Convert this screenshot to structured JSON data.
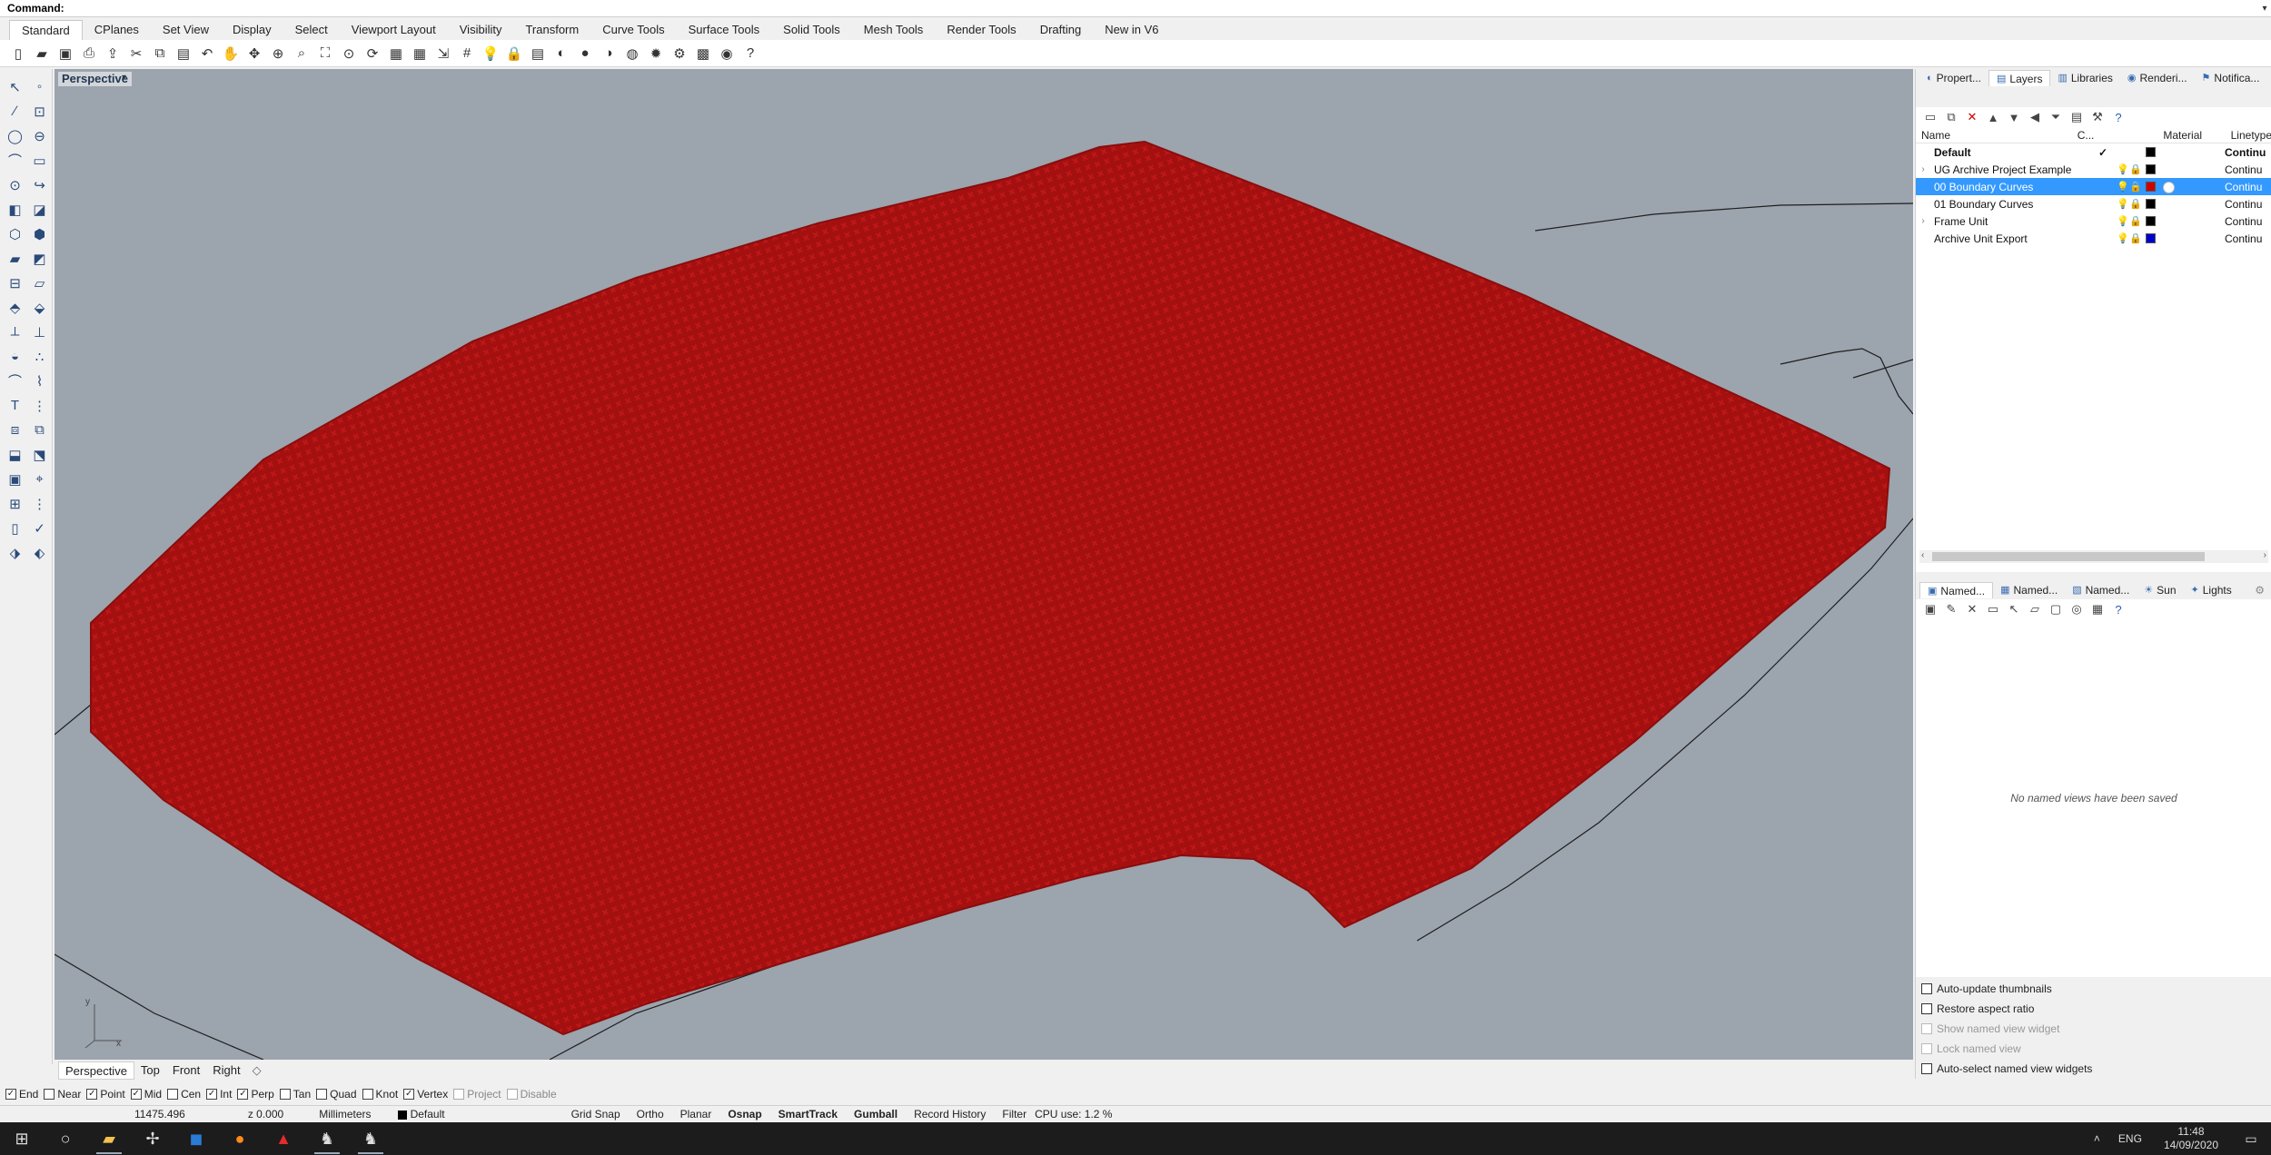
{
  "command": {
    "label": "Command:",
    "value": ""
  },
  "toolbar_tabs": [
    "Standard",
    "CPlanes",
    "Set View",
    "Display",
    "Select",
    "Viewport Layout",
    "Visibility",
    "Transform",
    "Curve Tools",
    "Surface Tools",
    "Solid Tools",
    "Mesh Tools",
    "Render Tools",
    "Drafting",
    "New in V6"
  ],
  "active_toolbar_tab": "Standard",
  "toolbar_icons": [
    "new-icon",
    "open-icon",
    "save-icon",
    "print-icon",
    "import-icon",
    "cut-icon",
    "copy-icon",
    "paste-icon",
    "undo-icon",
    "pan-icon",
    "move-icon",
    "zoom-icon",
    "zoom-window-icon",
    "zoom-extents-icon",
    "zoom-selected-icon",
    "rotate-view-icon",
    "four-view-icon",
    "cplane-icon",
    "set-cplane-icon",
    "grid-icon",
    "show-objects-icon",
    "lock-icon",
    "layer-icon",
    "color-icon",
    "rendered-icon",
    "shaded-icon",
    "render-icon",
    "lights-icon",
    "options-icon",
    "snapshot-icon",
    "web-icon",
    "help-icon"
  ],
  "viewport": {
    "name": "Perspective",
    "axis_x": "x",
    "axis_y": "y",
    "point_color": "#b00000",
    "background": "#9ca4ad"
  },
  "viewport_tabs": [
    "Perspective",
    "Top",
    "Front",
    "Right"
  ],
  "panel_tabs_top": [
    {
      "label": "Propert...",
      "icon": "properties-icon"
    },
    {
      "label": "Layers",
      "icon": "layers-icon",
      "active": true
    },
    {
      "label": "Libraries",
      "icon": "libraries-icon"
    },
    {
      "label": "Renderi...",
      "icon": "rendering-icon"
    },
    {
      "label": "Notifica...",
      "icon": "notifications-icon"
    }
  ],
  "layers": {
    "headers": {
      "name": "Name",
      "current": "C...",
      "material": "Material",
      "linetype": "Linetype"
    },
    "rows": [
      {
        "name": "Default",
        "current": "✓",
        "color": "#000000",
        "linetype": "Continu",
        "bold": true,
        "expand": ""
      },
      {
        "name": "UG Archive Project Example",
        "current": "",
        "color": "#000000",
        "linetype": "Continu",
        "expand": "›"
      },
      {
        "name": "00 Boundary Curves",
        "current": "",
        "color": "#d00000",
        "linetype": "Continu",
        "selected": true,
        "expand": ""
      },
      {
        "name": "01 Boundary Curves",
        "current": "",
        "color": "#000000",
        "linetype": "Continu",
        "expand": ""
      },
      {
        "name": "Frame Unit",
        "current": "",
        "color": "#000000",
        "linetype": "Continu",
        "expand": "›"
      },
      {
        "name": "Archive Unit Export",
        "current": "",
        "color": "#0000cc",
        "linetype": "Continu",
        "expand": ""
      }
    ]
  },
  "panel_tabs_bottom": [
    {
      "label": "Named...",
      "icon": "named-cplanes-icon",
      "active": true
    },
    {
      "label": "Named...",
      "icon": "named-views-icon"
    },
    {
      "label": "Named...",
      "icon": "named-positions-icon"
    },
    {
      "label": "Sun",
      "icon": "sun-icon"
    },
    {
      "label": "Lights",
      "icon": "lights-icon"
    }
  ],
  "named_views": {
    "empty_message": "No named views have been saved",
    "options": [
      {
        "label": "Auto-update thumbnails",
        "enabled": true
      },
      {
        "label": "Restore aspect ratio",
        "enabled": true
      },
      {
        "label": "Show named view widget",
        "enabled": false
      },
      {
        "label": "Lock named view",
        "enabled": false
      },
      {
        "label": "Auto-select named view widgets",
        "enabled": true
      }
    ]
  },
  "osnaps": [
    {
      "label": "End",
      "checked": true
    },
    {
      "label": "Near",
      "checked": false
    },
    {
      "label": "Point",
      "checked": true
    },
    {
      "label": "Mid",
      "checked": true
    },
    {
      "label": "Cen",
      "checked": false
    },
    {
      "label": "Int",
      "checked": true
    },
    {
      "label": "Perp",
      "checked": true
    },
    {
      "label": "Tan",
      "checked": false
    },
    {
      "label": "Quad",
      "checked": false
    },
    {
      "label": "Knot",
      "checked": false
    },
    {
      "label": "Vertex",
      "checked": true
    },
    {
      "label": "Project",
      "checked": false,
      "disabled": true
    },
    {
      "label": "Disable",
      "checked": false,
      "disabled": true
    }
  ],
  "status": {
    "coord_x": "11475.496",
    "coord_z": "z 0.000",
    "units": "Millimeters",
    "layer": "Default",
    "grid_snap": "Grid Snap",
    "ortho": "Ortho",
    "planar": "Planar",
    "osnap": "Osnap",
    "smarttrack": "SmartTrack",
    "gumball": "Gumball",
    "record_history": "Record History",
    "filter": "Filter",
    "cpu": "CPU use: 1.2 %"
  },
  "taskbar": {
    "lang": "ENG",
    "time": "11:48",
    "date": "14/09/2020"
  }
}
